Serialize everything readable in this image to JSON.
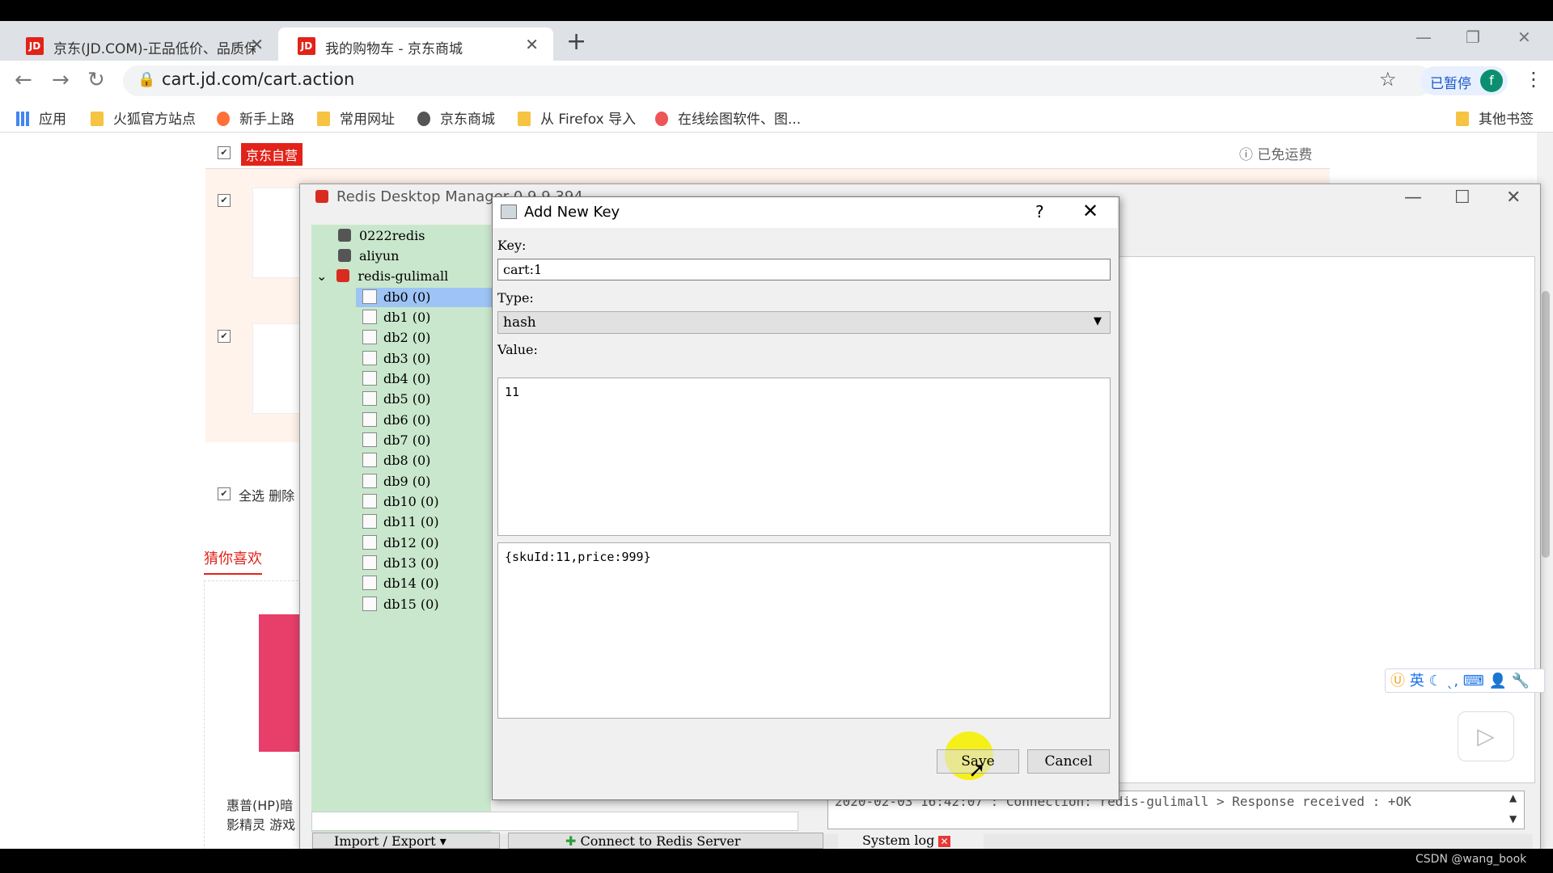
{
  "browser": {
    "tabs": [
      {
        "title": "京东(JD.COM)-正品低价、品质保",
        "favicon": "JD"
      },
      {
        "title": "我的购物车 - 京东商城",
        "favicon": "JD"
      }
    ],
    "url": "cart.jd.com/cart.action",
    "profile_label": "已暂停",
    "profile_initial": "f",
    "bookmarks": [
      "应用",
      "火狐官方站点",
      "新手上路",
      "常用网址",
      "京东商城",
      "从 Firefox 导入",
      "在线绘图软件、图...",
      "其他书签"
    ]
  },
  "jd_page": {
    "self_operated": "京东自营",
    "free_shipping": "已免运费",
    "select_all": "全选 删除",
    "guess_like": "猜你喜欢",
    "reco_item": "惠普(HP)暗影精灵 游戏笔记本电脑"
  },
  "rdm": {
    "window_title": "Redis Desktop Manager 0.9.9.394",
    "servers": [
      "0222redis",
      "aliyun",
      "redis-gulimall"
    ],
    "databases": [
      "db0 (0)",
      "db1 (0)",
      "db2 (0)",
      "db3 (0)",
      "db4 (0)",
      "db5 (0)",
      "db6 (0)",
      "db7 (0)",
      "db8 (0)",
      "db9 (0)",
      "db10 (0)",
      "db11 (0)",
      "db12 (0)",
      "db13 (0)",
      "db14 (0)",
      "db15 (0)"
    ],
    "log_line": "2020-02-03 16:42:07 : Connection: redis-gulimall > Response received : +OK",
    "import_export": "Import / Export",
    "connect_label": "Connect to Redis Server",
    "system_log": "System log"
  },
  "dialog": {
    "title": "Add New Key",
    "help": "?",
    "key_label": "Key:",
    "key_value": "cart:1",
    "type_label": "Type:",
    "type_value": "hash",
    "value_label": "Value:",
    "hash_key": "11",
    "hash_value": "{skuId:11,price:999}",
    "save_label": "Save",
    "cancel_label": "Cancel"
  },
  "ime": "英",
  "watermark": "CSDN @wang_book"
}
